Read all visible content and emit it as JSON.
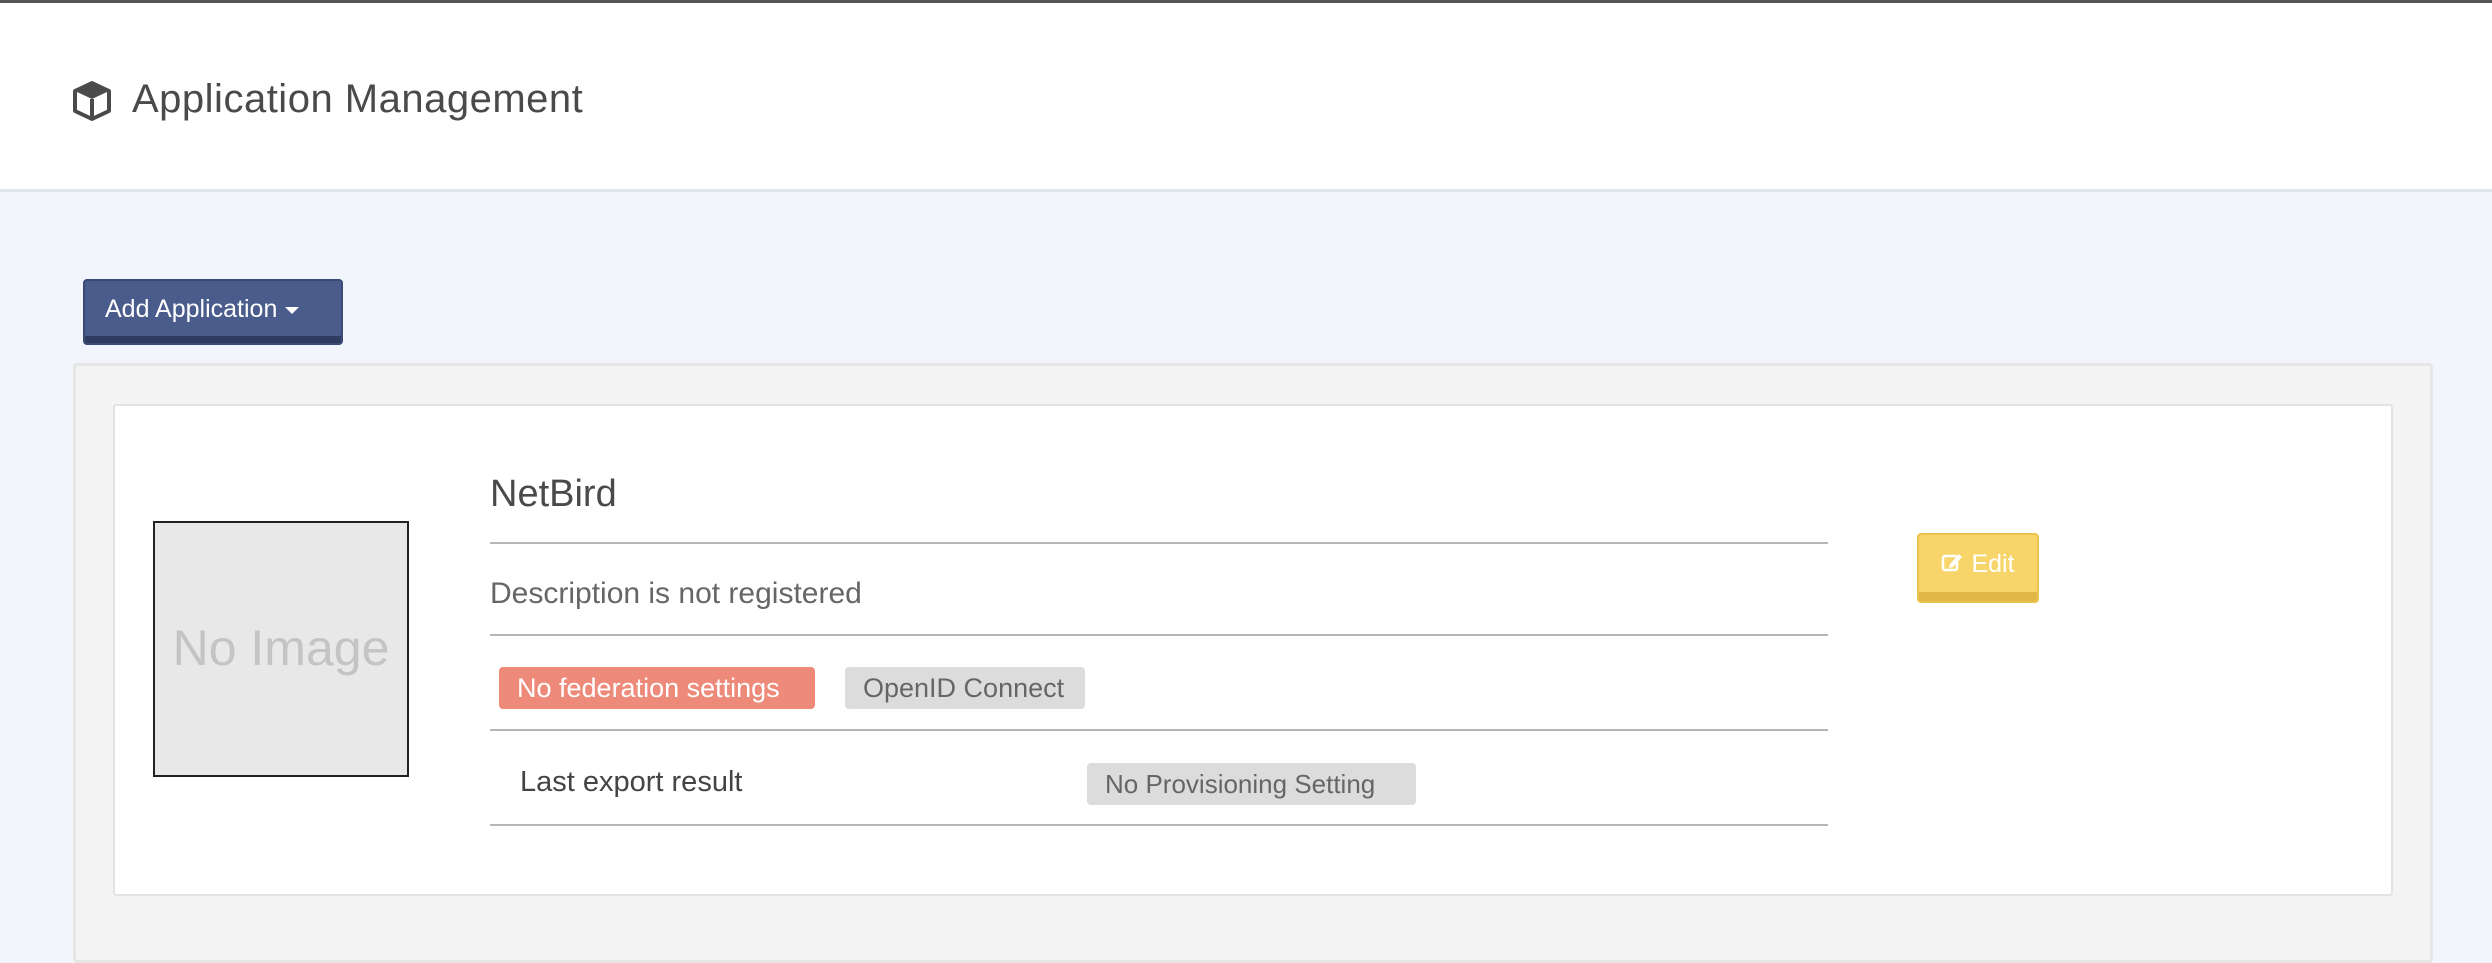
{
  "header": {
    "title": "Application Management",
    "icon": "cube-icon"
  },
  "toolbar": {
    "add_application_label": "Add Application"
  },
  "applications": [
    {
      "name": "NetBird",
      "image_placeholder": "No Image",
      "description": "Description is not registered",
      "badges": [
        {
          "label": "No federation settings",
          "color": "#ee8a7a"
        },
        {
          "label": "OpenID Connect",
          "color": "#dcdcdc"
        }
      ],
      "last_export_label": "Last export result",
      "provisioning_status": "No Provisioning Setting",
      "edit_label": "Edit"
    }
  ],
  "colors": {
    "primary_button": "#4a5c8c",
    "edit_button": "#f7d56a",
    "page_background": "#f2f6fc"
  }
}
